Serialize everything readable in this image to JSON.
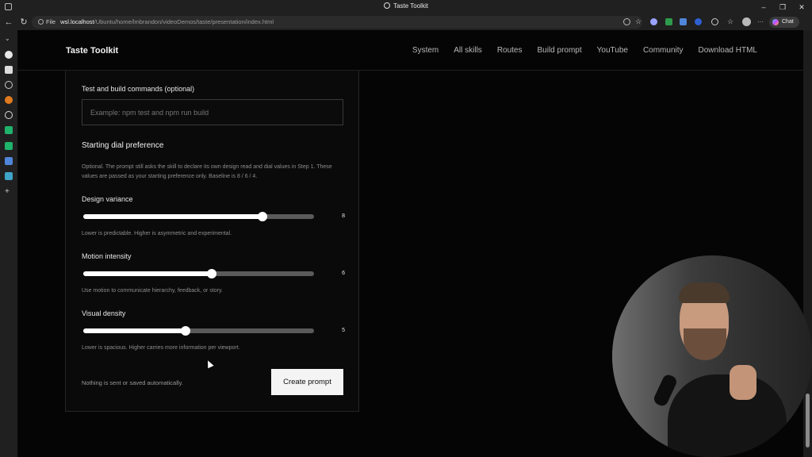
{
  "browser": {
    "window_title": "Taste Toolkit",
    "url_scheme": "File",
    "url_host": "wsl.localhost",
    "url_path": "/Ubuntu/home/lmbrandon/videoDemos/taste/presentation/index.html",
    "chat_label": "Chat"
  },
  "site": {
    "brand": "Taste Toolkit",
    "nav": [
      "System",
      "All skills",
      "Routes",
      "Build prompt",
      "YouTube",
      "Community",
      "Download HTML"
    ]
  },
  "form": {
    "test_build_label": "Test and build commands (optional)",
    "test_build_placeholder": "Example: npm test and npm run build",
    "dial_heading": "Starting dial preference",
    "dial_help": "Optional. The prompt still asks the skill to declare its own design read and dial values in Step 1. These values are passed as your starting preference only. Baseline is 8 / 6 / 4.",
    "sliders": [
      {
        "label": "Design variance",
        "value": 8,
        "min": 1,
        "max": 10,
        "help": "Lower is predictable. Higher is asymmetric and experimental."
      },
      {
        "label": "Motion intensity",
        "value": 6,
        "min": 1,
        "max": 10,
        "help": "Use motion to communicate hierarchy, feedback, or story."
      },
      {
        "label": "Visual density",
        "value": 5,
        "min": 1,
        "max": 10,
        "help": "Lower is spacious. Higher carries more information per viewport."
      }
    ],
    "note": "Nothing is sent or saved automatically.",
    "create_button": "Create prompt"
  }
}
